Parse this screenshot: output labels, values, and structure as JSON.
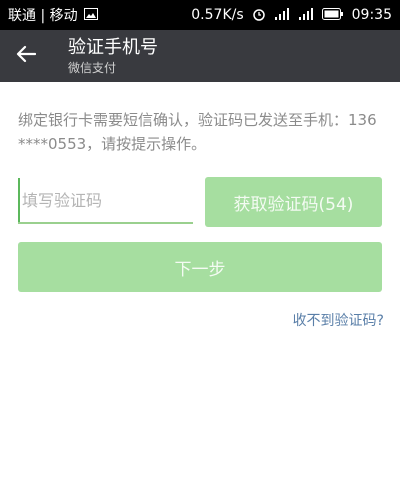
{
  "status_bar": {
    "carrier": "联通 | 移动",
    "speed": "0.57K/s",
    "time": "09:35"
  },
  "header": {
    "title": "验证手机号",
    "subtitle": "微信支付"
  },
  "main": {
    "description": "绑定银行卡需要短信确认，验证码已发送至手机：136****0553，请按提示操作。",
    "code_input": {
      "placeholder": "填写验证码",
      "value": ""
    },
    "get_code_button": "获取验证码(54)",
    "next_button": "下一步",
    "no_code_link": "收不到验证码?"
  },
  "colors": {
    "accent_green": "#a6dea0",
    "header_bg": "#393a3f",
    "link_blue": "#5a7fa8"
  }
}
